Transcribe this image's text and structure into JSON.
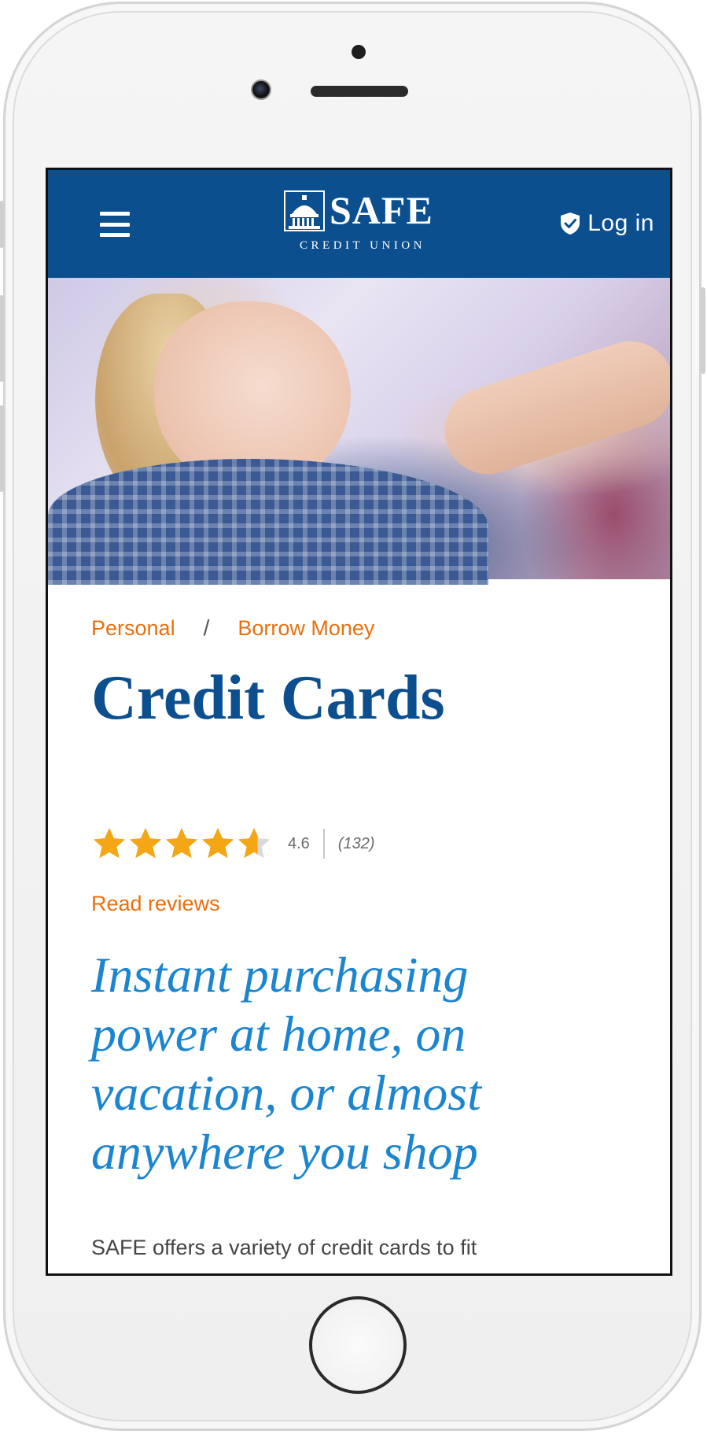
{
  "header": {
    "menu_icon": "hamburger-menu-icon",
    "logo_word": "SAFE",
    "logo_subtitle": "CREDIT UNION",
    "logo_icon": "capitol-dome-icon",
    "login_icon": "shield-check-icon",
    "login_label": "Log in",
    "background_color": "#0b4f8f"
  },
  "hero": {
    "image": "woman-reaching-to-shelf-photo"
  },
  "breadcrumb": {
    "items": [
      "Personal",
      "Borrow Money"
    ],
    "separator": "/"
  },
  "page": {
    "title": "Credit Cards"
  },
  "rating": {
    "value": "4.6",
    "count": "(132)",
    "stars_filled": 4.6,
    "stars_total": 5,
    "star_color": "#f5a614",
    "read_reviews": "Read reviews"
  },
  "tagline": {
    "lines": [
      "Instant purchasing",
      "power at home, on",
      "vacation, or almost",
      "anywhere you shop"
    ]
  },
  "intro": {
    "text": "SAFE offers a variety of credit cards to fit"
  },
  "colors": {
    "brand_blue": "#0b4f8f",
    "accent_orange": "#e8700f",
    "tagline_blue": "#1b85cf"
  }
}
